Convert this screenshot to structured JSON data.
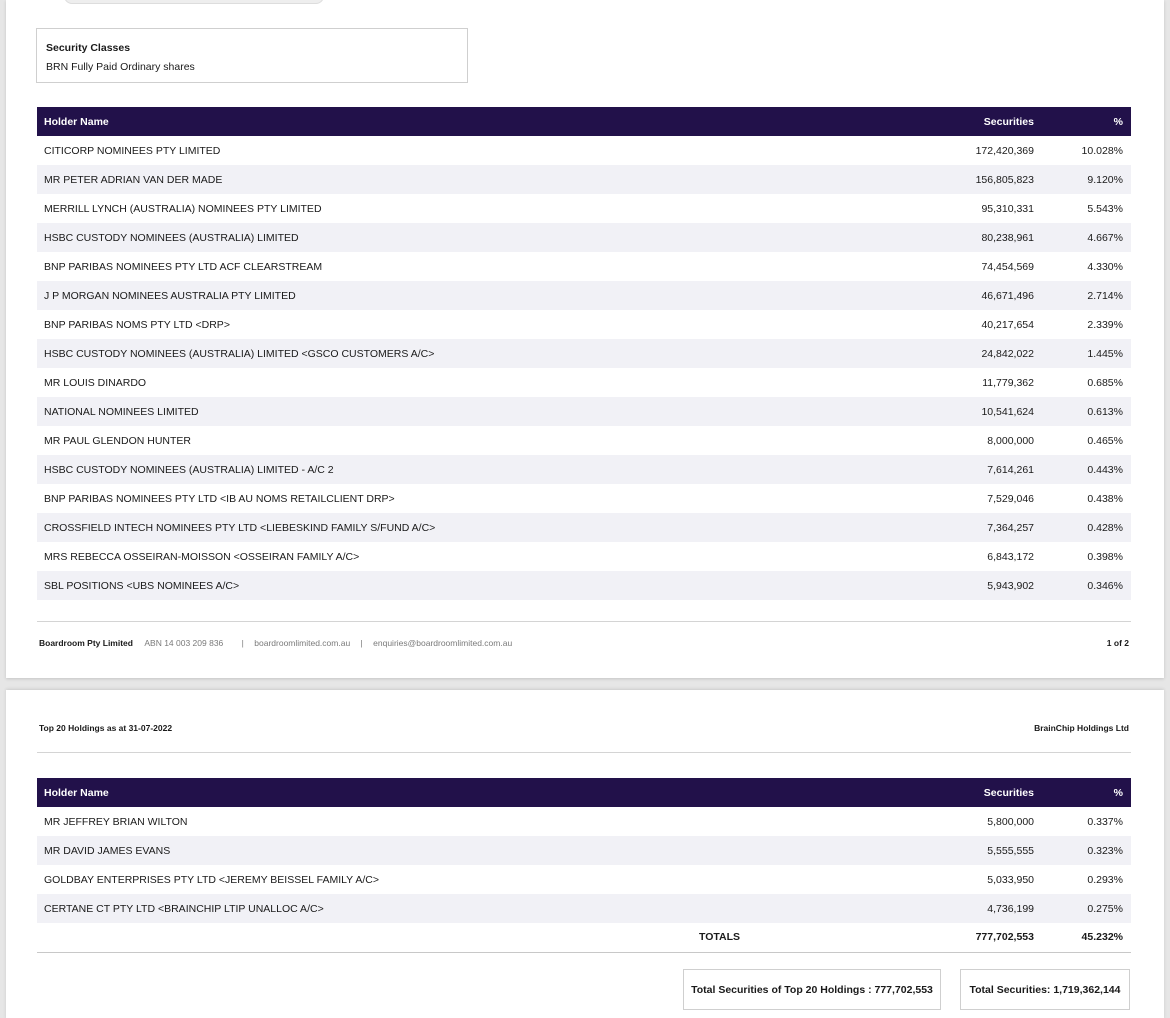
{
  "security_classes": {
    "title": "Security Classes",
    "value": "BRN Fully Paid Ordinary shares"
  },
  "table_headers": {
    "holder": "Holder Name",
    "securities": "Securities",
    "percent": "%"
  },
  "page1_rows": [
    {
      "holder": "CITICORP NOMINEES PTY LIMITED",
      "securities": "172,420,369",
      "percent": "10.028%"
    },
    {
      "holder": "MR PETER ADRIAN VAN DER MADE",
      "securities": "156,805,823",
      "percent": "9.120%"
    },
    {
      "holder": "MERRILL LYNCH (AUSTRALIA) NOMINEES PTY LIMITED",
      "securities": "95,310,331",
      "percent": "5.543%"
    },
    {
      "holder": "HSBC CUSTODY NOMINEES (AUSTRALIA) LIMITED",
      "securities": "80,238,961",
      "percent": "4.667%"
    },
    {
      "holder": "BNP PARIBAS NOMINEES PTY LTD ACF CLEARSTREAM",
      "securities": "74,454,569",
      "percent": "4.330%"
    },
    {
      "holder": "J P MORGAN NOMINEES AUSTRALIA PTY LIMITED",
      "securities": "46,671,496",
      "percent": "2.714%"
    },
    {
      "holder": "BNP PARIBAS NOMS PTY LTD <DRP>",
      "securities": "40,217,654",
      "percent": "2.339%"
    },
    {
      "holder": "HSBC CUSTODY NOMINEES (AUSTRALIA) LIMITED <GSCO CUSTOMERS A/C>",
      "securities": "24,842,022",
      "percent": "1.445%"
    },
    {
      "holder": "MR LOUIS DINARDO",
      "securities": "11,779,362",
      "percent": "0.685%"
    },
    {
      "holder": "NATIONAL NOMINEES LIMITED",
      "securities": "10,541,624",
      "percent": "0.613%"
    },
    {
      "holder": "MR PAUL GLENDON HUNTER",
      "securities": "8,000,000",
      "percent": "0.465%"
    },
    {
      "holder": "HSBC CUSTODY NOMINEES (AUSTRALIA) LIMITED - A/C 2",
      "securities": "7,614,261",
      "percent": "0.443%"
    },
    {
      "holder": "BNP PARIBAS NOMINEES PTY LTD <IB AU NOMS RETAILCLIENT DRP>",
      "securities": "7,529,046",
      "percent": "0.438%"
    },
    {
      "holder": "CROSSFIELD INTECH NOMINEES PTY LTD <LIEBESKIND FAMILY S/FUND A/C>",
      "securities": "7,364,257",
      "percent": "0.428%"
    },
    {
      "holder": "MRS REBECCA OSSEIRAN-MOISSON <OSSEIRAN FAMILY A/C>",
      "securities": "6,843,172",
      "percent": "0.398%"
    },
    {
      "holder": "SBL POSITIONS <UBS NOMINEES A/C>",
      "securities": "5,943,902",
      "percent": "0.346%"
    }
  ],
  "footer": {
    "company": "Boardroom Pty Limited",
    "abn": "ABN 14 003 209 836",
    "website": "boardroomlimited.com.au",
    "email": "enquiries@boardroomlimited.com.au",
    "page_number": "1 of 2"
  },
  "page2_header": {
    "left": "Top 20 Holdings as at 31-07-2022",
    "right": "BrainChip Holdings Ltd"
  },
  "page2_rows": [
    {
      "holder": "MR JEFFREY BRIAN WILTON",
      "securities": "5,800,000",
      "percent": "0.337%"
    },
    {
      "holder": "MR DAVID JAMES EVANS",
      "securities": "5,555,555",
      "percent": "0.323%"
    },
    {
      "holder": "GOLDBAY ENTERPRISES PTY LTD <JEREMY BEISSEL FAMILY A/C>",
      "securities": "5,033,950",
      "percent": "0.293%"
    },
    {
      "holder": "CERTANE CT PTY LTD <BRAINCHIP LTIP UNALLOC A/C>",
      "securities": "4,736,199",
      "percent": "0.275%"
    }
  ],
  "totals": {
    "label": "TOTALS",
    "securities": "777,702,553",
    "percent": "45.232%"
  },
  "summary": {
    "top20": "Total Securities of Top 20 Holdings : 777,702,553",
    "total": "Total Securities: 1,719,362,144"
  },
  "colors": {
    "header_bg": "#22114a",
    "stripe_bg": "#f1f1f6"
  }
}
